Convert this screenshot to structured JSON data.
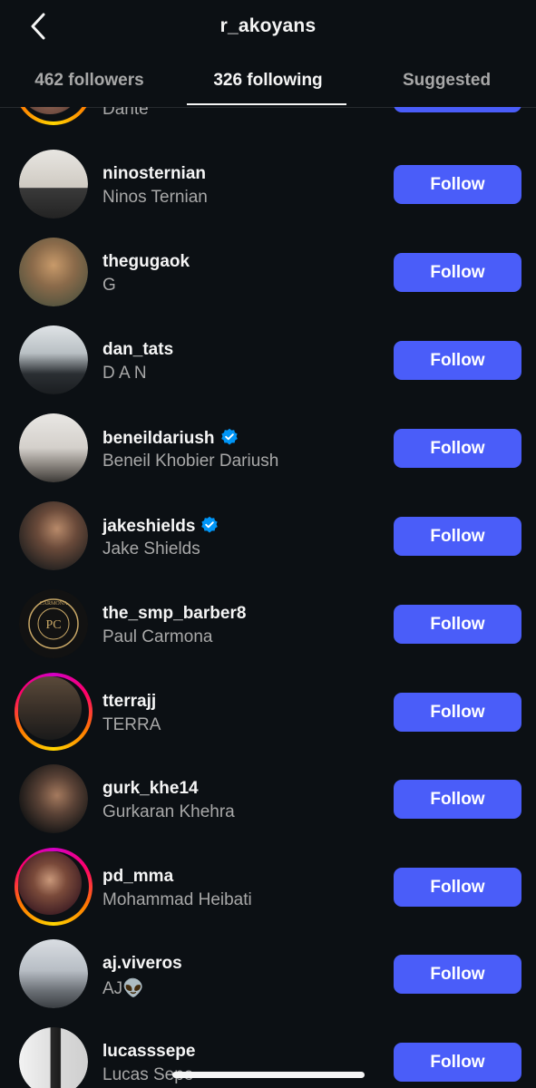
{
  "header": {
    "title": "r_akoyans",
    "back_icon": "chevron-left-icon"
  },
  "tabs": [
    {
      "label": "462 followers",
      "active": false
    },
    {
      "label": "326 following",
      "active": true
    },
    {
      "label": "Suggested",
      "active": false
    }
  ],
  "colors": {
    "background": "#0c1014",
    "follow_button": "#4a5df9",
    "verified_badge": "#0095f6",
    "secondary_text": "#a8a8a8"
  },
  "partial_row": {
    "full_name": "Dante"
  },
  "follow_label": "Follow",
  "following_list": [
    {
      "username": "ninosternian",
      "full_name": "Ninos Ternian",
      "verified": false,
      "story_ring": false
    },
    {
      "username": "thegugaok",
      "full_name": "G",
      "verified": false,
      "story_ring": false
    },
    {
      "username": "dan_tats",
      "full_name": "D A N",
      "verified": false,
      "story_ring": false
    },
    {
      "username": "beneildariush",
      "full_name": "Beneil Khobier Dariush",
      "verified": true,
      "story_ring": false
    },
    {
      "username": "jakeshields",
      "full_name": "Jake Shields",
      "verified": true,
      "story_ring": false
    },
    {
      "username": "the_smp_barber8",
      "full_name": "Paul Carmona",
      "verified": false,
      "story_ring": false
    },
    {
      "username": "tterrajj",
      "full_name": "TERRA",
      "verified": false,
      "story_ring": true
    },
    {
      "username": "gurk_khe14",
      "full_name": "Gurkaran Khehra",
      "verified": false,
      "story_ring": false
    },
    {
      "username": "pd_mma",
      "full_name": "Mohammad Heibati",
      "verified": false,
      "story_ring": true
    },
    {
      "username": "aj.viveros",
      "full_name": "AJ👽",
      "verified": false,
      "story_ring": false
    },
    {
      "username": "lucasssepe",
      "full_name": "Lucas Sepe",
      "verified": false,
      "story_ring": false
    }
  ]
}
